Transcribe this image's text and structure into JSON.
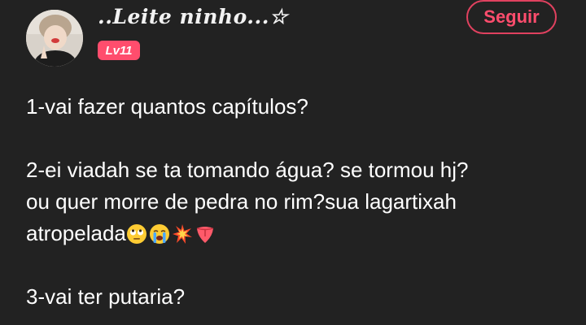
{
  "header": {
    "username": "..Leite ninho...☆",
    "level_badge": "Lv11",
    "follow_label": "Seguir"
  },
  "post": {
    "line1": "1-vai fazer quantos capítulos?",
    "line2": "2-ei viadah  se ta tomando água? se tormou hj?",
    "line3": "ou quer morre de pedra no rim?sua lagartixah",
    "line4": "atropelada",
    "line5": "3-vai ter putaria?"
  },
  "emojis": [
    "eye-roll-emoji",
    "loudly-crying-emoji",
    "collision-emoji",
    "tongue-emoji"
  ],
  "colors": {
    "background": "#222222",
    "accent": "#ff4d6d",
    "text": "#ffffff"
  }
}
